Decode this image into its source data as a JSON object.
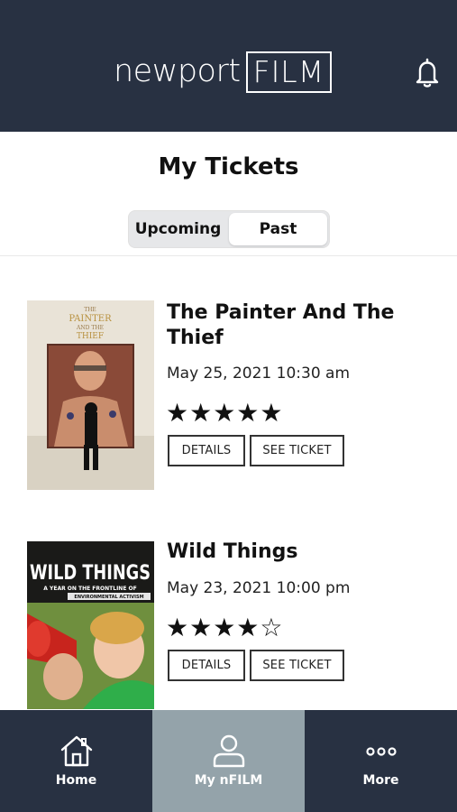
{
  "header": {
    "logo_text": "newport",
    "logo_box": "FILM",
    "bell_icon": "bell-icon"
  },
  "page": {
    "title": "My Tickets"
  },
  "toggle": {
    "upcoming": "Upcoming",
    "past": "Past",
    "selected": "Past"
  },
  "tickets": [
    {
      "title": "The Painter And The Thief",
      "date": "May 25, 2021 10:30 am",
      "stars": "★★★★★",
      "rating": 5,
      "details_label": "DETAILS",
      "see_ticket_label": "SEE TICKET",
      "poster": {
        "line1": "THE",
        "line2": "PAINTER",
        "line3": "AND THE",
        "line4": "THIEF"
      }
    },
    {
      "title": "Wild Things",
      "date": "May 23, 2021 10:00 pm",
      "stars": "★★★★☆",
      "rating": 4,
      "details_label": "DETAILS",
      "see_ticket_label": "SEE TICKET",
      "poster": {
        "headline": "WILD THINGS",
        "tagline": "A YEAR ON THE FRONTLINE OF",
        "tagline2": "ENVIRONMENTAL ACTIVISM"
      }
    }
  ],
  "tabbar": {
    "home": "Home",
    "my_nfilm": "My nFILM",
    "more": "More",
    "active": "My nFILM"
  },
  "colors": {
    "header_bg": "#283142",
    "active_tab_bg": "#94a3aa",
    "text": "#111111"
  }
}
